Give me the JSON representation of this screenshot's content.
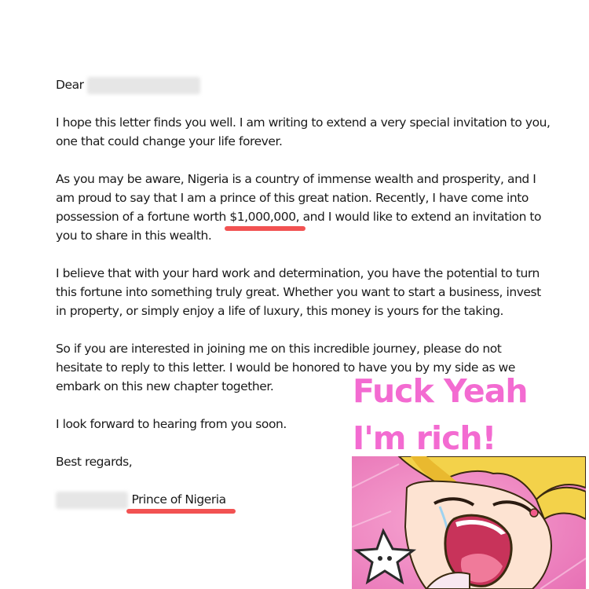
{
  "letter": {
    "greeting": "Dear",
    "p1": "I hope this letter finds you well. I am writing to extend a very special invitation to you, one that could change your life forever.",
    "p2_pre": "As you may be aware, Nigeria is a country of immense wealth and prosperity, and I am proud to say that I am a prince of this great nation. Recently, I have come into possession of a fortune worth ",
    "p2_amount": "$1,000,000",
    "p2_post": ", and I would like to extend an invitation to you to share in this wealth.",
    "p3": "I believe that with your hard work and determination, you have the potential to turn this fortune into something truly great. Whether you want to start a business, invest in property, or simply enjoy a life of luxury, this money is yours for the taking.",
    "p4": "So if you are interested in joining me on this incredible journey, please do not hesitate to reply to this letter. I would be honored to have you by my side as we embark on this new chapter together.",
    "p5": "I look forward to hearing from you soon.",
    "closing": "Best regards,",
    "signature_title": "Prince of Nigeria"
  },
  "meme": {
    "line1": "Fuck Yeah",
    "line2": "I'm rich!",
    "text_color": "#f36bd1"
  },
  "colors": {
    "underline": "#f25252",
    "background": "#ffffff"
  }
}
